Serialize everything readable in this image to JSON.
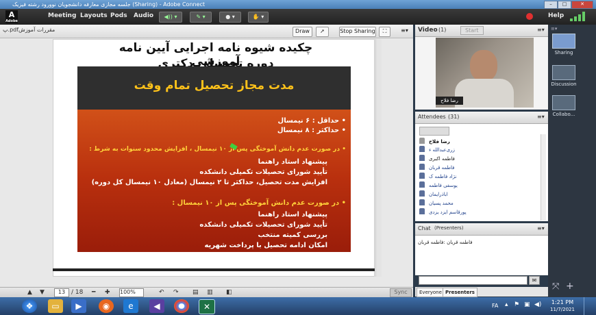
{
  "window": {
    "title": "جلسه مجازی معارفه دانشجویان نوورود رشته فیزیک  (Sharing) - Adobe Connect",
    "minimize": "–",
    "maximize": "□",
    "close": "✕"
  },
  "menu": {
    "logo_text": "A",
    "logo_sub": "Adobe",
    "items": [
      "Meeting",
      "Layouts",
      "Pods",
      "Audio"
    ],
    "help": "Help"
  },
  "share_pod": {
    "filename": "پ.pdfمقررات آموزش",
    "draw_label": "Draw",
    "stop_sharing_label": "Stop Sharing",
    "sync_label": "Sync",
    "page_current": "13",
    "page_total": "/ 18",
    "zoom": "100%"
  },
  "slide": {
    "title_line1": "چکیده شیوه نامه اجرایی آیین نامه آموزشی",
    "title_line2": "دوره تحصیلی دکتری",
    "heading": "مدت مجاز تحصیل تمام وقت",
    "bullets": [
      "•  حداقل : ۶ نیمسال",
      "•  حداکثر : ۸ نیمسال"
    ],
    "section1_title": "•  در صورت عدم دانش آموختگی پس از ۱۰ نیمسال ، افزایش محدود سنوات به شرط :",
    "section1_items": [
      "پیشنهاد استاد راهنما",
      "تأیید شورای تحصیلات تکمیلی دانشکده",
      "افزایش مدت تحصیل، حداکثر تا ۲ نیمسال (معادل ۱۰ نیمسال کل دوره)"
    ],
    "section2_title": "•  در صورت عدم دانش آموختگی پس از ۱۰ نیمسال :",
    "section2_items": [
      "پیشنهاد استاد راهنما",
      "تأیید شورای تحصیلات تکمیلی دانشکده",
      "بررسی کمیته منتخب",
      "امکان ادامه تحصیل با پرداخت شهریه"
    ]
  },
  "video_pod": {
    "title": "Video",
    "count": "(1)",
    "start_label": "Start",
    "caption": "رضا فلاح"
  },
  "attendees_pod": {
    "title": "Attendees",
    "count": "(31)",
    "host": "رضا فلاح",
    "list": [
      "زری‌عبدالله ء",
      "فاطمه اکبری",
      "فاطمه قربان",
      "نژاد فاطمه ک",
      "یوسفی فاطمه",
      "اباذر‌ایمان",
      "محمد پسیان",
      "پورقاسم ایزد یزدی"
    ]
  },
  "chat_pod": {
    "title": "Chat",
    "subtitle": "(Presenters)",
    "message": "فاطمه قربان :فاطمه قربان",
    "tab_everyone": "Everyone",
    "tab_presenters": "Presenters"
  },
  "rail": {
    "items": [
      "Sharing",
      "Discussion",
      "Collabo..."
    ]
  },
  "taskbar": {
    "lang": "FA",
    "time": "1:21 PM",
    "date": "11/7/2021"
  },
  "colors": {
    "slide_orange": "#d4541a",
    "slide_dark": "#2f2f2f",
    "heading_yellow": "#ffc21a"
  }
}
